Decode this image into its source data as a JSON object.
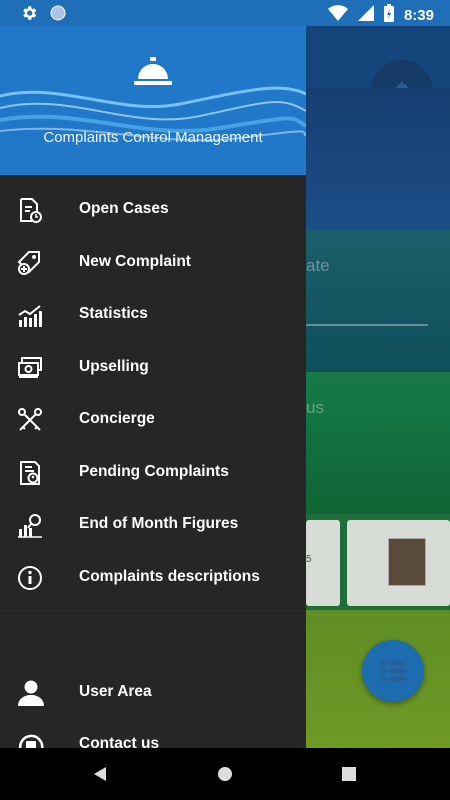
{
  "status_bar": {
    "time": "8:39",
    "icons": [
      "settings-icon",
      "circle-icon",
      "wifi-icon",
      "cellular-icon",
      "battery-charging-icon"
    ]
  },
  "drawer": {
    "header": {
      "title": "Complaints Control Management",
      "logo_icon": "service-bell-icon"
    },
    "menu": [
      {
        "label": "Open Cases",
        "icon": "document-clock-icon"
      },
      {
        "label": "New Complaint",
        "icon": "tag-add-icon"
      },
      {
        "label": "Statistics",
        "icon": "bar-chart-icon"
      },
      {
        "label": "Upselling",
        "icon": "cash-icon"
      },
      {
        "label": "Concierge",
        "icon": "crossed-keys-icon"
      },
      {
        "label": "Pending Complaints",
        "icon": "document-person-icon"
      },
      {
        "label": "End of Month Figures",
        "icon": "chart-search-icon"
      },
      {
        "label": "Complaints descriptions",
        "icon": "info-icon"
      }
    ],
    "bottom": [
      {
        "label": "User Area",
        "icon": "user-icon"
      },
      {
        "label": "Contact us",
        "icon": "contact-icon"
      }
    ]
  },
  "background": {
    "partial_text_1": "ate",
    "partial_text_2": "us",
    "partial_text_3": "5"
  },
  "colors": {
    "status_bar": "#1f6fb8",
    "drawer_header": "#2178c9",
    "drawer_bg": "#262626",
    "fab": "#1e6cb0"
  }
}
